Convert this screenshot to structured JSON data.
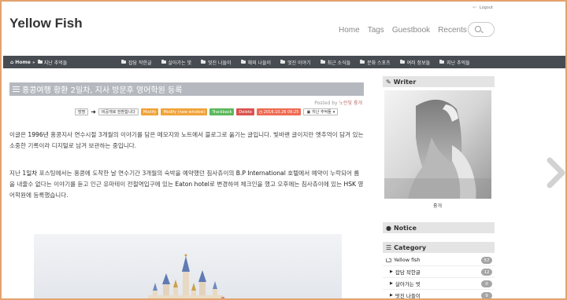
{
  "login": {
    "label": "Logout"
  },
  "site": {
    "title": "Yellow Fish"
  },
  "topnav": [
    "Home",
    "Tags",
    "Guestbook",
    "Recents"
  ],
  "category_bar": {
    "home": "Home",
    "current": "지난 추억들",
    "items": [
      "잡담 작한글",
      "살아가는 멋",
      "멋진 나들이",
      "해외 나들이",
      "멋진 이야기",
      "최근 소식들",
      "문화 스포츠",
      "여러 정보들",
      "지난 추억들"
    ]
  },
  "post": {
    "title": "홍콩여행 황환 2일차, 지사 방문후 영어학원 등록",
    "posted_by_label": "Posted by",
    "author": "노란빛 흉개",
    "tools": {
      "list": "방명",
      "related": "비공개로 전환합니다",
      "modify": "Modify",
      "modify_new": "Modify (new window)",
      "trackback": "Trackback",
      "delete": "Delete",
      "date": "2016.10.26 06:25",
      "category": "지난 추억들"
    },
    "para1_parts": [
      "이글은 ",
      "1996년",
      " 홍콩지사 연수시절 3개월의 이야기를 담은 메모지와 노트에서 블로그로 옮기는 글입니다. 빛바랜 글이지만 옛추억이 담겨 있는 소중한 기록이라 디지털로 남겨 보관하는 중입니다."
    ],
    "para2_parts": [
      "지난 ",
      "1일차",
      " 포스팅에서는 홍콩에 도착한 날 연수기간 3개월의 숙박을 예약했던 침사츄이의 ",
      "B.P International",
      " 호텔에서 예약이 누락되어 룸을 내줄수 없다는 이야기를 듣고 인근 유마테이 전철역입구에 있는 ",
      "Eaton hotel",
      "로 변경하여 체크인을 했고 오후에는 침사츄이에 있는 ",
      "HSK",
      " 영어학원에 등록했습니다."
    ]
  },
  "sidebar": {
    "writer": {
      "title": "Writer",
      "name": "흉개"
    },
    "notice": {
      "title": "Notice"
    },
    "category": {
      "title": "Category",
      "items": [
        {
          "label": "Yellow fish",
          "count": "57"
        },
        {
          "label": "잡담 작한글",
          "count": "12"
        },
        {
          "label": "살아가는 멋",
          "count": "0"
        },
        {
          "label": "멋진 나들이",
          "count": "9"
        }
      ]
    }
  },
  "colors": {
    "accent_border": "#e2a36e",
    "category_bar": "#474c52",
    "title_bar": "#b5b9bf",
    "badge": "#a5a5a5"
  },
  "icons": [
    "logout-icon",
    "search-icon",
    "home-icon",
    "folder-icon",
    "menu-icon",
    "pencil-icon",
    "comment-icon",
    "list-icon",
    "chevron-right-icon"
  ]
}
